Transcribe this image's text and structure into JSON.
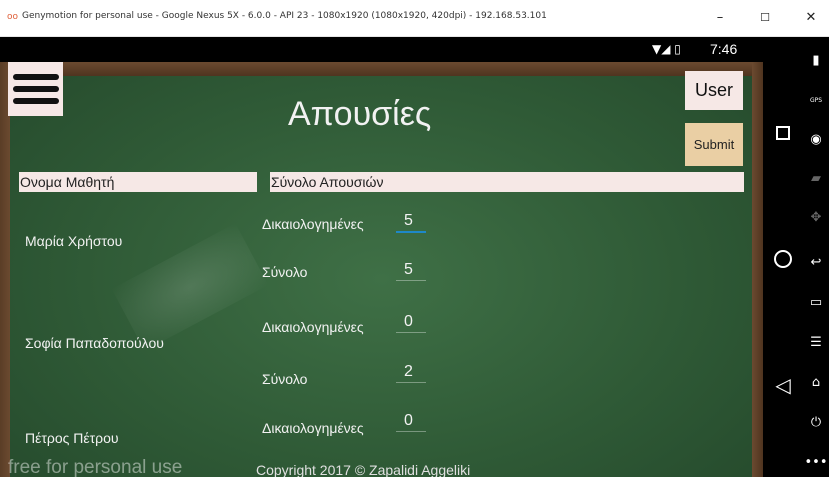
{
  "window": {
    "title": "Genymotion for personal use - Google Nexus 5X - 6.0.0 - API 23 - 1080x1920 (1080x1920, 420dpi) - 192.168.53.101",
    "app_icon": "genymotion-logo",
    "minimize": "–",
    "maximize": "☐",
    "close": "✕"
  },
  "statusbar": {
    "icons": "▼◢ ▯",
    "time": "7:46"
  },
  "app": {
    "title": "Απουσίες",
    "user_button": "User",
    "submit_button": "Submit",
    "header_name": "Ονομα Μαθητή",
    "header_total": "Σύνολο Απουσιών",
    "students": [
      {
        "name": "Μαρία Χρήστου",
        "justified_label": "Δικαιολογημένες",
        "justified_value": "5",
        "total_label": "Σύνολο",
        "total_value": "5"
      },
      {
        "name": "Σοφία Παπαδοπούλου",
        "justified_label": "Δικαιολογημένες",
        "justified_value": "0",
        "total_label": "Σύνολο",
        "total_value": "2"
      },
      {
        "name": "Πέτρος Πέτρου",
        "justified_label": "Δικαιολογημένες",
        "justified_value": "0"
      }
    ],
    "footer": "Copyright 2017 ©    Zapalidi Aggeliki",
    "watermark": "free for personal use"
  },
  "nav": {
    "recents_icon": "recents-square-icon",
    "home_icon": "home-circle-icon",
    "back_icon": "back-triangle-icon"
  },
  "toolbar": {
    "icons": [
      "battery-icon",
      "gps-icon",
      "camera-icon",
      "video-icon",
      "dpad-icon",
      "rotate-icon",
      "back-icon",
      "recents-icon",
      "menu-icon",
      "home-icon",
      "power-icon",
      "more-icon"
    ],
    "gps_label": "GPS"
  },
  "colors": {
    "chalkboard": "#2f5a36",
    "frame_wood": "#6b4a30",
    "header_bg": "#f6e8e6",
    "submit_bg": "#eacfa4",
    "focus_accent": "#1e88c8"
  }
}
